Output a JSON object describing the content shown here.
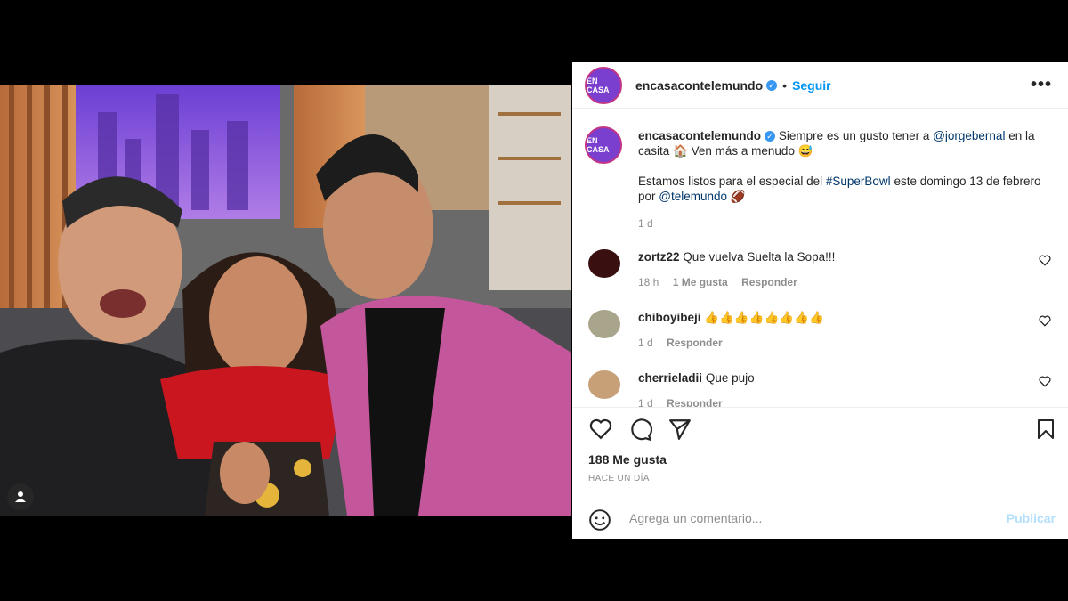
{
  "post": {
    "username": "encasacontelemundo",
    "follow_label": "Seguir",
    "dot": "•",
    "more_label": "•••",
    "avatar_text": "EN CASA"
  },
  "caption": {
    "username": "encasacontelemundo",
    "text_1": "Siempre es un gusto tener a",
    "mention_1": "@jorgebernal",
    "text_2": "en la casita",
    "emoji_1": "🏠",
    "text_3": "Ven más a menudo",
    "emoji_2": "😅",
    "text_4": "Estamos listos para el especial del",
    "hashtag": "#SuperBowl",
    "text_5": "este domingo 13 de febrero por",
    "mention_2": "@telemundo",
    "emoji_3": "🏈",
    "time": "1 d"
  },
  "comments": [
    {
      "user": "zortz22",
      "text": "Que vuelva Suelta la Sopa!!!",
      "time": "18 h",
      "likes": "1 Me gusta",
      "reply": "Responder"
    },
    {
      "user": "chiboyibeji",
      "text": "👍👍👍👍👍👍👍👍",
      "time": "1 d",
      "reply": "Responder"
    },
    {
      "user": "cherrieladii",
      "text": "Que pujo",
      "time": "1 d",
      "reply": "Responder"
    }
  ],
  "actions": {
    "likes": "188 Me gusta",
    "posted": "HACE UN DÍA"
  },
  "add_comment": {
    "placeholder": "Agrega un comentario...",
    "publish": "Publicar"
  },
  "colors": {
    "accent": "#0095f6",
    "verified": "#3897f0",
    "jacket": "#c4579b",
    "backdrop": "#8a4fcf"
  }
}
